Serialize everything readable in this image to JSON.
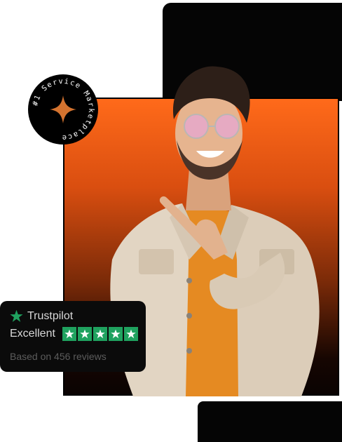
{
  "badge": {
    "text": "#1 Service Marketplace",
    "star_color": "#d4732f"
  },
  "trustpilot": {
    "brand": "Trustpilot",
    "rating_label": "Excellent",
    "rating_stars": 5,
    "star_color": "#1fa25f",
    "reviews_text": "Based on 456 reviews"
  },
  "colors": {
    "accent": "#ff6a1a",
    "panel": "#050505"
  }
}
